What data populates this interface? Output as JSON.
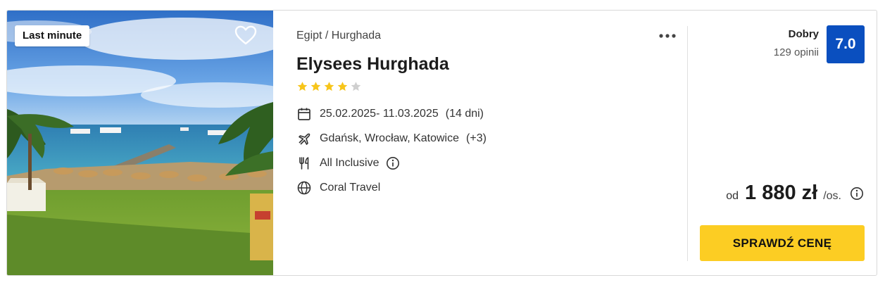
{
  "offer": {
    "badge": "Last minute",
    "breadcrumb": "Egipt / Hurghada",
    "hotel_name": "Elysees Hurghada",
    "stars": {
      "rating": 4,
      "max": 5
    },
    "dates": "25.02.2025- 11.03.2025",
    "duration": "(14 dni)",
    "departure": "Gdańsk, Wrocław, Katowice",
    "departure_more": "(+3)",
    "board": "All Inclusive",
    "operator": "Coral Travel"
  },
  "rating": {
    "label": "Dobry",
    "count": "129 opinii",
    "score": "7.0"
  },
  "price": {
    "prefix": "od",
    "value": "1 880 zł",
    "suffix": "/os."
  },
  "cta": {
    "label": "SPRAWDŹ CENĘ"
  },
  "colors": {
    "accent": "#fccd23",
    "score_bg": "#0a4fbf",
    "star": "#f7c51a",
    "star_empty": "#cfcfcf"
  },
  "icons": [
    "heart-icon",
    "more-dots-icon",
    "star-icon",
    "calendar-icon",
    "plane-icon",
    "cutlery-icon",
    "info-icon",
    "globe-icon"
  ]
}
